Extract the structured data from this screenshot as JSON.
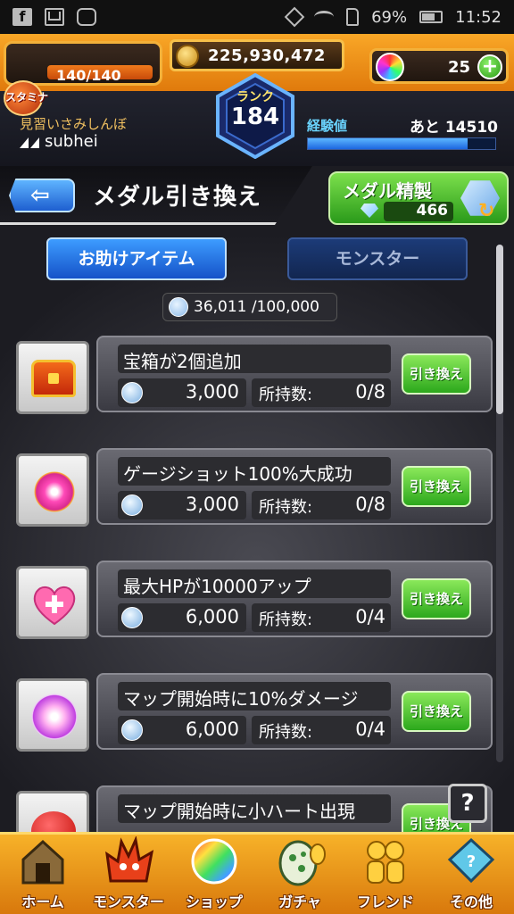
{
  "statusbar": {
    "battery": "69%",
    "time": "11:52"
  },
  "hud": {
    "stamina_label": "スタミナ",
    "stamina": "140/140",
    "stamina_fill": 1.0,
    "coins": "225,930,472",
    "orbs": "25",
    "rank_label": "ランク",
    "rank": "184",
    "player_title": "見習いさみしんぼ",
    "player_name": "subhei",
    "exp_label": "経験値",
    "exp_remaining": "あと 14510",
    "exp_fill": 0.85
  },
  "header": {
    "back_glyph": "⇦",
    "title": "メダル引き換え",
    "refine_label": "メダル精製",
    "refine_count": "466"
  },
  "tabs": [
    {
      "label": "お助けアイテム",
      "active": true
    },
    {
      "label": "モンスター",
      "active": false
    }
  ],
  "medals": {
    "count": "36,011 /100,000"
  },
  "items": [
    {
      "name": "宝箱が2個追加",
      "cost": "3,000",
      "own_label": "所持数:",
      "own": "0/8",
      "button": "引き換え",
      "icon": "treasure-chest-icon"
    },
    {
      "name": "ゲージショット100%大成功",
      "cost": "3,000",
      "own_label": "所持数:",
      "own": "0/8",
      "button": "引き換え",
      "icon": "gauge-shot-icon"
    },
    {
      "name": "最大HPが10000アップ",
      "cost": "6,000",
      "own_label": "所持数:",
      "own": "0/4",
      "button": "引き換え",
      "icon": "heart-plus-icon"
    },
    {
      "name": "マップ開始時に10%ダメージ",
      "cost": "6,000",
      "own_label": "所持数:",
      "own": "0/4",
      "button": "引き換え",
      "icon": "burst-orb-icon"
    },
    {
      "name": "マップ開始時に小ハート出現",
      "cost": "",
      "own_label": "",
      "own": "",
      "button": "引き換え",
      "icon": "apple-heart-icon"
    }
  ],
  "help_label": "?",
  "nav": [
    {
      "label": "ホーム",
      "icon": "home-icon"
    },
    {
      "label": "モンスター",
      "icon": "monster-icon"
    },
    {
      "label": "ショップ",
      "icon": "orb-shop-icon"
    },
    {
      "label": "ガチャ",
      "icon": "egg-gacha-icon"
    },
    {
      "label": "フレンド",
      "icon": "friend-icon"
    },
    {
      "label": "その他",
      "icon": "other-icon"
    }
  ]
}
